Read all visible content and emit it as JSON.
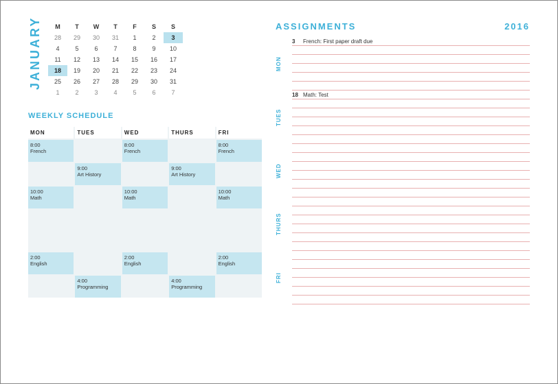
{
  "month_label": "JANUARY",
  "calendar": {
    "dow": [
      "M",
      "T",
      "W",
      "T",
      "F",
      "S",
      "S"
    ],
    "rows": [
      [
        {
          "n": "28"
        },
        {
          "n": "29"
        },
        {
          "n": "30"
        },
        {
          "n": "31"
        },
        {
          "n": "1",
          "in": true
        },
        {
          "n": "2",
          "in": true
        },
        {
          "n": "3",
          "in": true,
          "hl": true
        }
      ],
      [
        {
          "n": "4",
          "in": true
        },
        {
          "n": "5",
          "in": true
        },
        {
          "n": "6",
          "in": true
        },
        {
          "n": "7",
          "in": true
        },
        {
          "n": "8",
          "in": true
        },
        {
          "n": "9",
          "in": true
        },
        {
          "n": "10",
          "in": true
        }
      ],
      [
        {
          "n": "11",
          "in": true
        },
        {
          "n": "12",
          "in": true
        },
        {
          "n": "13",
          "in": true
        },
        {
          "n": "14",
          "in": true
        },
        {
          "n": "15",
          "in": true
        },
        {
          "n": "16",
          "in": true
        },
        {
          "n": "17",
          "in": true
        }
      ],
      [
        {
          "n": "18",
          "in": true,
          "hl": true
        },
        {
          "n": "19",
          "in": true
        },
        {
          "n": "20",
          "in": true
        },
        {
          "n": "21",
          "in": true
        },
        {
          "n": "22",
          "in": true
        },
        {
          "n": "23",
          "in": true
        },
        {
          "n": "24",
          "in": true
        }
      ],
      [
        {
          "n": "25",
          "in": true
        },
        {
          "n": "26",
          "in": true
        },
        {
          "n": "27",
          "in": true
        },
        {
          "n": "28",
          "in": true
        },
        {
          "n": "29",
          "in": true
        },
        {
          "n": "30",
          "in": true
        },
        {
          "n": "31",
          "in": true
        }
      ],
      [
        {
          "n": "1"
        },
        {
          "n": "2"
        },
        {
          "n": "3"
        },
        {
          "n": "4"
        },
        {
          "n": "5"
        },
        {
          "n": "6"
        },
        {
          "n": "7"
        }
      ]
    ]
  },
  "weekly_title": "WEEKLY SCHEDULE",
  "schedule": {
    "headers": [
      "MON",
      "TUES",
      "WED",
      "THURS",
      "FRI"
    ],
    "rows": [
      [
        {
          "t": "8:00\nFrench",
          "f": true
        },
        {
          "t": ""
        },
        {
          "t": "8:00\nFrench",
          "f": true
        },
        {
          "t": ""
        },
        {
          "t": "8:00\nFrench",
          "f": true
        }
      ],
      [
        {
          "t": ""
        },
        {
          "t": "9:00\nArt History",
          "f": true
        },
        {
          "t": ""
        },
        {
          "t": "9:00\nArt History",
          "f": true
        },
        {
          "t": ""
        }
      ],
      [
        {
          "t": "10:00\nMath",
          "f": true
        },
        {
          "t": ""
        },
        {
          "t": "10:00\nMath",
          "f": true
        },
        {
          "t": ""
        },
        {
          "t": "10:00\nMath",
          "f": true
        }
      ],
      [
        {
          "t": ""
        },
        {
          "t": ""
        },
        {
          "t": ""
        },
        {
          "t": ""
        },
        {
          "t": ""
        }
      ],
      [
        {
          "t": "2:00\nEnglish",
          "f": true
        },
        {
          "t": ""
        },
        {
          "t": "2:00\nEnglish",
          "f": true
        },
        {
          "t": ""
        },
        {
          "t": "2:00\nEnglish",
          "f": true
        }
      ],
      [
        {
          "t": ""
        },
        {
          "t": "4:00\nProgramming",
          "f": true
        },
        {
          "t": ""
        },
        {
          "t": "4:00\nProgramming",
          "f": true
        },
        {
          "t": ""
        }
      ]
    ]
  },
  "assignments": {
    "title": "ASSIGNMENTS",
    "year": "2016",
    "days": [
      {
        "label": "MON",
        "lines": [
          {
            "date": "3",
            "text": "French: First paper draft due"
          },
          {},
          {},
          {},
          {},
          {}
        ]
      },
      {
        "label": "TUES",
        "lines": [
          {
            "date": "18",
            "text": "Math: Test"
          },
          {},
          {},
          {},
          {},
          {}
        ]
      },
      {
        "label": "WED",
        "lines": [
          {},
          {},
          {},
          {},
          {},
          {}
        ]
      },
      {
        "label": "THURS",
        "lines": [
          {},
          {},
          {},
          {},
          {},
          {}
        ]
      },
      {
        "label": "FRI",
        "lines": [
          {},
          {},
          {},
          {},
          {},
          {}
        ]
      }
    ]
  }
}
